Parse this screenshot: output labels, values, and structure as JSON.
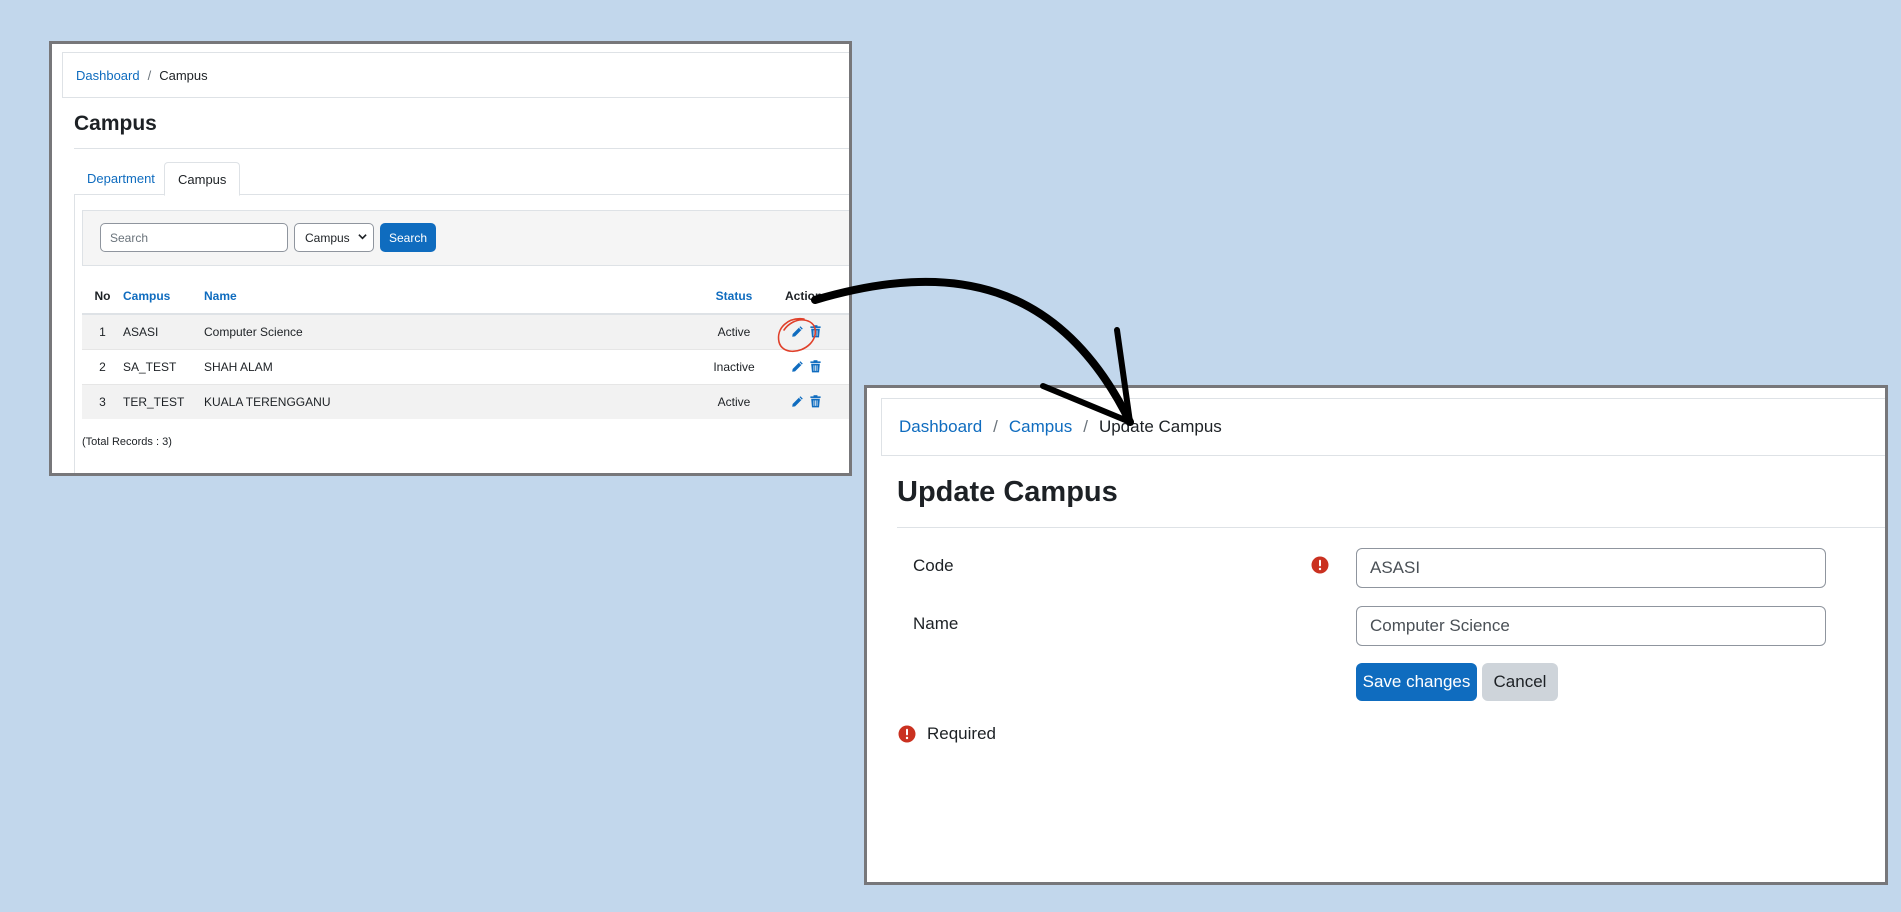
{
  "list_page": {
    "breadcrumb": {
      "dashboard": "Dashboard",
      "current": "Campus"
    },
    "title": "Campus",
    "tabs": [
      {
        "label": "Department"
      },
      {
        "label": "Campus"
      }
    ],
    "search": {
      "placeholder": "Search",
      "filter_value": "Campus",
      "button": "Search"
    },
    "table": {
      "headers": {
        "no": "No",
        "campus": "Campus",
        "name": "Name",
        "status": "Status",
        "action": "Action"
      },
      "rows": [
        {
          "no": "1",
          "campus": "ASASI",
          "name": "Computer Science",
          "status": "Active"
        },
        {
          "no": "2",
          "campus": "SA_TEST",
          "name": "SHAH ALAM",
          "status": "Inactive"
        },
        {
          "no": "3",
          "campus": "TER_TEST",
          "name": "KUALA TERENGGANU",
          "status": "Active"
        }
      ]
    },
    "total_records": "(Total Records : 3)"
  },
  "edit_page": {
    "breadcrumb": {
      "dashboard": "Dashboard",
      "campus": "Campus",
      "current": "Update Campus"
    },
    "title": "Update Campus",
    "fields": {
      "code": {
        "label": "Code",
        "value": "ASASI"
      },
      "name": {
        "label": "Name",
        "value": "Computer Science"
      }
    },
    "buttons": {
      "save": "Save changes",
      "cancel": "Cancel"
    },
    "required_note": "Required"
  },
  "colors": {
    "background": "#c2d7ec",
    "link": "#0f6cbf",
    "primary_button": "#0f6cbf",
    "secondary_button": "#ced4da",
    "required_icon": "#ca3120",
    "annotation": "#e0402a"
  },
  "icons": [
    "pencil-icon",
    "trash-icon",
    "exclamation-circle-icon",
    "chevron-down-icon",
    "curved-arrow"
  ]
}
